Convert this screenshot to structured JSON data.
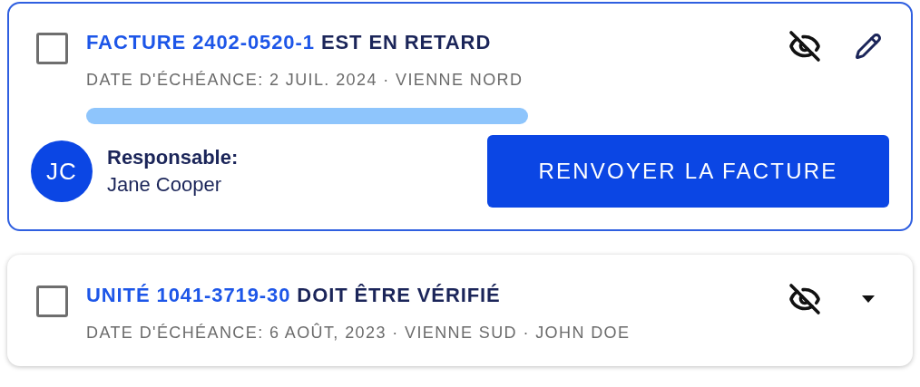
{
  "cards": [
    {
      "selected": true,
      "checked": false,
      "expanded": true,
      "title_link": "FACTURE 2402-0520-1",
      "title_rest": "EST EN RETARD",
      "meta": "DATE D'ÉCHÉANCE: 2 JUIL. 2024 · VIENNE NORD",
      "actions": [
        {
          "kind": "hide"
        },
        {
          "kind": "edit"
        }
      ],
      "assignee": {
        "initials": "JC",
        "label": "Responsable:",
        "name": "Jane Cooper"
      },
      "button": "RENVOYER LA FACTURE"
    },
    {
      "selected": false,
      "checked": false,
      "expanded": false,
      "title_link": "UNITÉ 1041-3719-30",
      "title_rest": "DOIT ÊTRE VÉRIFIÉ",
      "meta": "DATE D'ÉCHÉANCE: 6 AOÛT, 2023 · VIENNE SUD · JOHN DOE",
      "actions": [
        {
          "kind": "hide"
        },
        {
          "kind": "expand"
        }
      ]
    }
  ]
}
